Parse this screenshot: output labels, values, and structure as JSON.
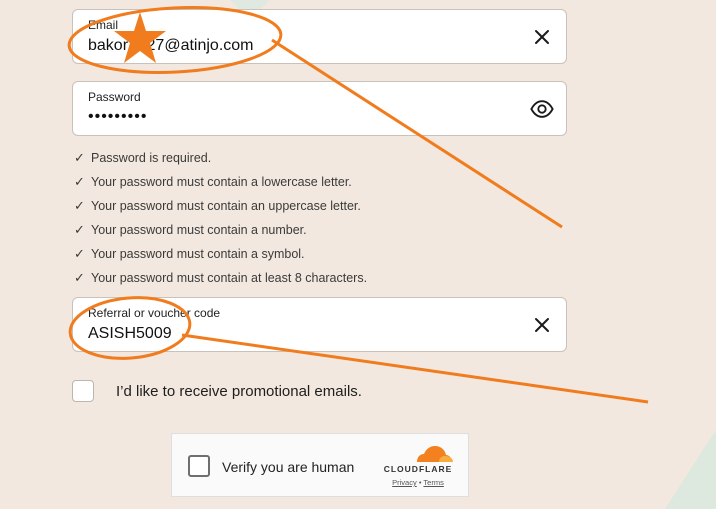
{
  "email": {
    "label": "Email",
    "value": "bakor   027@atinjo.com",
    "icon": "close-icon"
  },
  "password": {
    "label": "Password",
    "value": "•••••••••",
    "icon": "eye-icon"
  },
  "rules": [
    {
      "check": "✓",
      "text": "Password is required."
    },
    {
      "check": "✓",
      "text": "Your password must contain a lowercase letter."
    },
    {
      "check": "✓",
      "text": "Your password must contain an uppercase letter."
    },
    {
      "check": "✓",
      "text": "Your password must contain a number."
    },
    {
      "check": "✓",
      "text": "Your password must contain a symbol."
    },
    {
      "check": "✓",
      "text": "Your password must contain at least 8 characters."
    }
  ],
  "referral": {
    "label": "Referral or voucher code",
    "value": "ASISH5009",
    "icon": "close-icon"
  },
  "promo": {
    "label": "I’d like to receive promotional emails.",
    "checked": false
  },
  "captcha": {
    "label": "Verify you are human",
    "brand": "CLOUDFLARE",
    "privacy": "Privacy",
    "separator": "•",
    "terms": "Terms"
  },
  "colors": {
    "background": "#f2e8df",
    "annotation": "#f07c1e",
    "cloudflare": "#f48120"
  }
}
